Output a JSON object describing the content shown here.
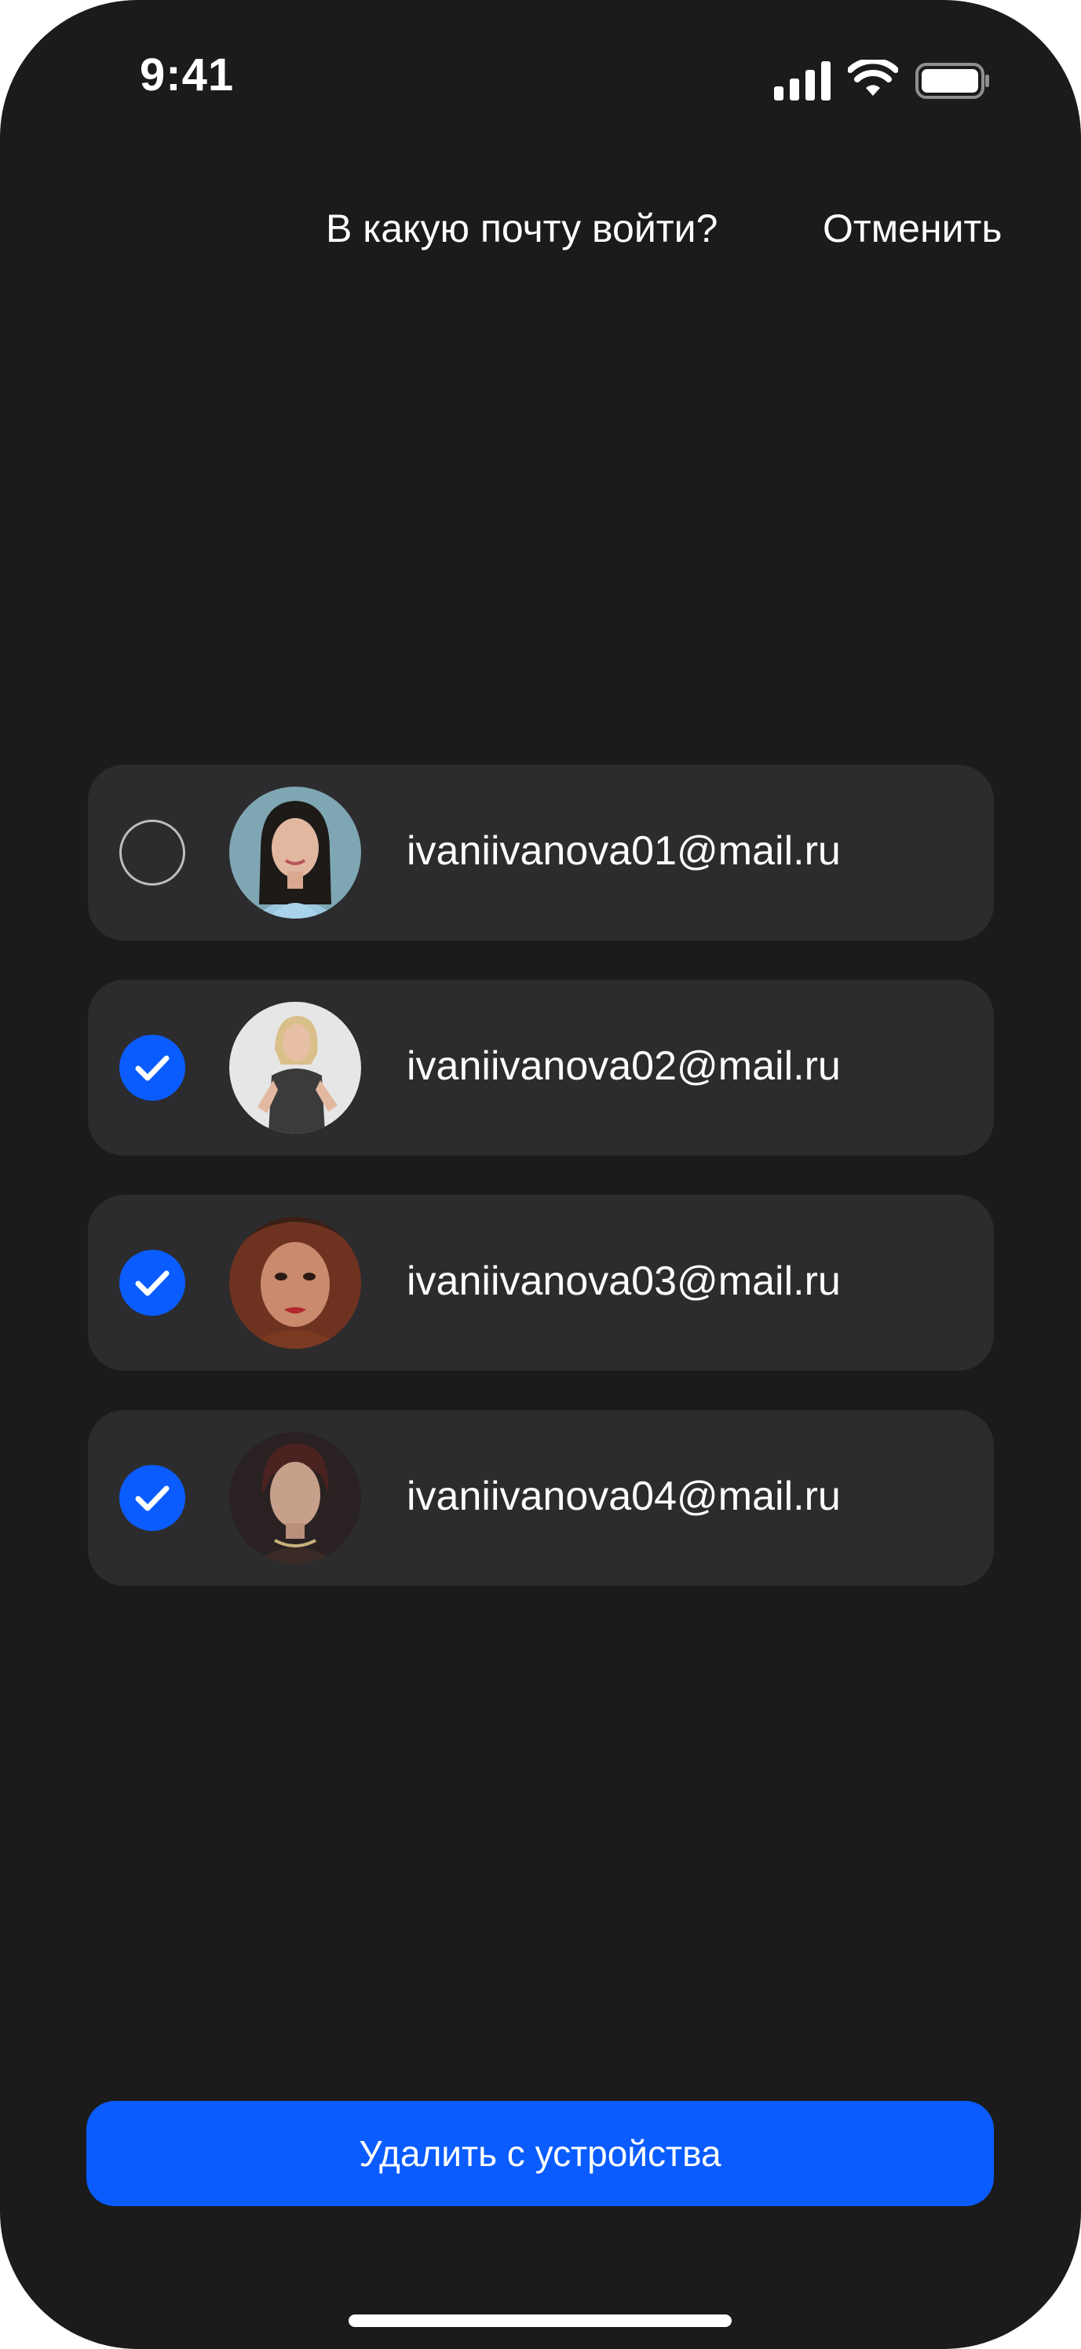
{
  "status_bar": {
    "time": "9:41",
    "signal_icon": "cellular-signal-icon",
    "wifi_icon": "wifi-icon",
    "battery_icon": "battery-icon"
  },
  "header": {
    "title": "В какую почту войти?",
    "cancel_label": "Отменить"
  },
  "accounts": [
    {
      "email": "ivaniivanova01@mail.ru",
      "selected": false
    },
    {
      "email": "ivaniivanova02@mail.ru",
      "selected": true
    },
    {
      "email": "ivaniivanova03@mail.ru",
      "selected": true
    },
    {
      "email": "ivaniivanova04@mail.ru",
      "selected": true
    }
  ],
  "footer": {
    "delete_label": "Удалить с устройства"
  },
  "colors": {
    "background": "#1b1b1b",
    "card": "#2c2c2e",
    "accent": "#0a5cff",
    "text": "#ffffff"
  }
}
